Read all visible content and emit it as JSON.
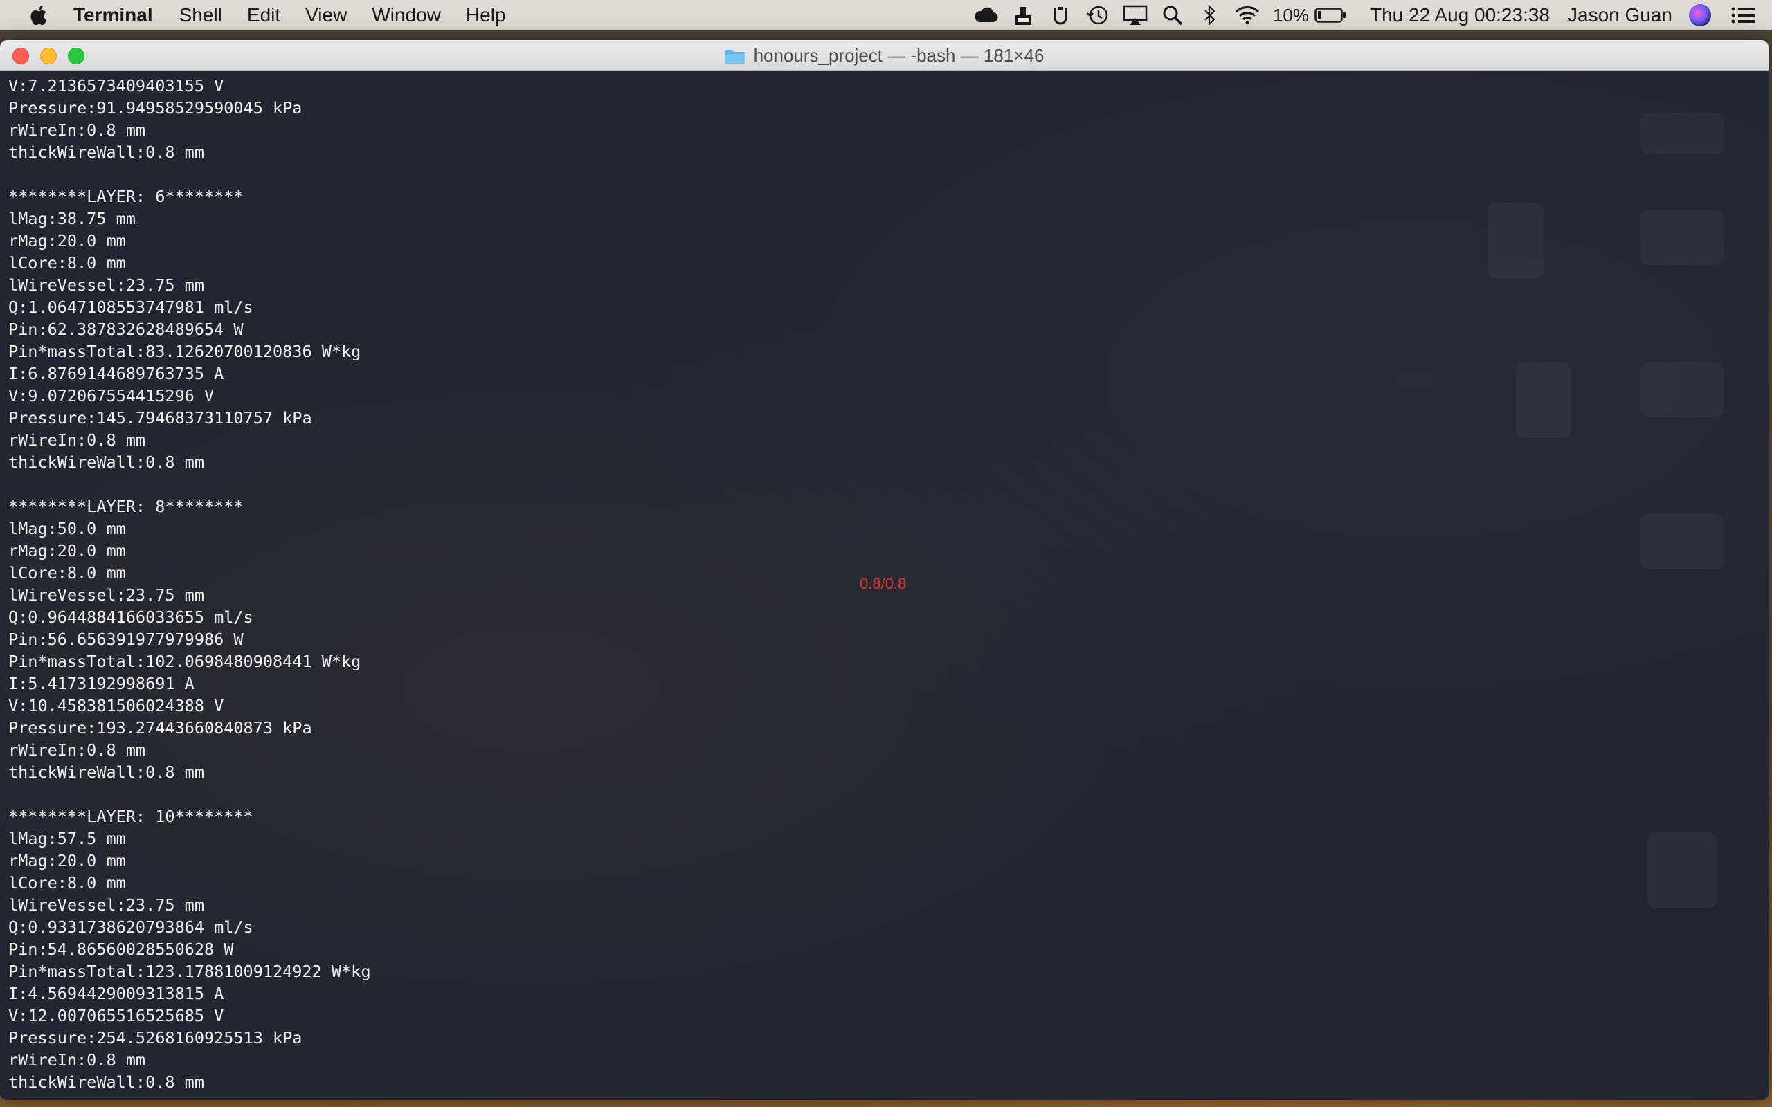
{
  "menubar": {
    "app_name": "Terminal",
    "items": [
      "Shell",
      "Edit",
      "View",
      "Window",
      "Help"
    ],
    "battery_percent": "10%",
    "datetime": "Thu 22 Aug  00:23:38",
    "user": "Jason Guan",
    "status_icons": [
      "creative-cloud-icon",
      "share-icon",
      "text-input-icon",
      "time-machine-icon",
      "airplay-icon",
      "spotlight-icon",
      "bluetooth-icon",
      "wifi-icon",
      "battery-icon",
      "siri-icon",
      "notification-list-icon"
    ]
  },
  "window": {
    "title": "honours_project — -bash — 181×46"
  },
  "terminal": {
    "lines": [
      "V:7.2136573409403155 V",
      "Pressure:91.94958529590045 kPa",
      "rWireIn:0.8 mm",
      "thickWireWall:0.8 mm",
      "",
      "********LAYER: 6********",
      "lMag:38.75 mm",
      "rMag:20.0 mm",
      "lCore:8.0 mm",
      "lWireVessel:23.75 mm",
      "Q:1.0647108553747981 ml/s",
      "Pin:62.387832628489654 W",
      "Pin*massTotal:83.12620700120836 W*kg",
      "I:6.8769144689763735 A",
      "V:9.072067554415296 V",
      "Pressure:145.79468373110757 kPa",
      "rWireIn:0.8 mm",
      "thickWireWall:0.8 mm",
      "",
      "********LAYER: 8********",
      "lMag:50.0 mm",
      "rMag:20.0 mm",
      "lCore:8.0 mm",
      "lWireVessel:23.75 mm",
      "Q:0.9644884166033655 ml/s",
      "Pin:56.656391977979986 W",
      "Pin*massTotal:102.0698480908441 W*kg",
      "I:5.4173192998691 A",
      "V:10.458381506024388 V",
      "Pressure:193.27443660840873 kPa",
      "rWireIn:0.8 mm",
      "thickWireWall:0.8 mm",
      "",
      "********LAYER: 10********",
      "lMag:57.5 mm",
      "rMag:20.0 mm",
      "lCore:8.0 mm",
      "lWireVessel:23.75 mm",
      "Q:0.9331738620793864 ml/s",
      "Pin:54.86560028550628 W",
      "Pin*massTotal:123.17881009124922 W*kg",
      "I:4.5694429009313815 A",
      "V:12.007065516525685 V",
      "Pressure:254.5268160925513 kPa",
      "rWireIn:0.8 mm",
      "thickWireWall:0.8 mm"
    ],
    "overlay_text": "0.8/0.8"
  },
  "colors": {
    "terminal_bg": "#222632",
    "terminal_fg": "#f2f2f2",
    "overlay_red": "#e0322a"
  }
}
